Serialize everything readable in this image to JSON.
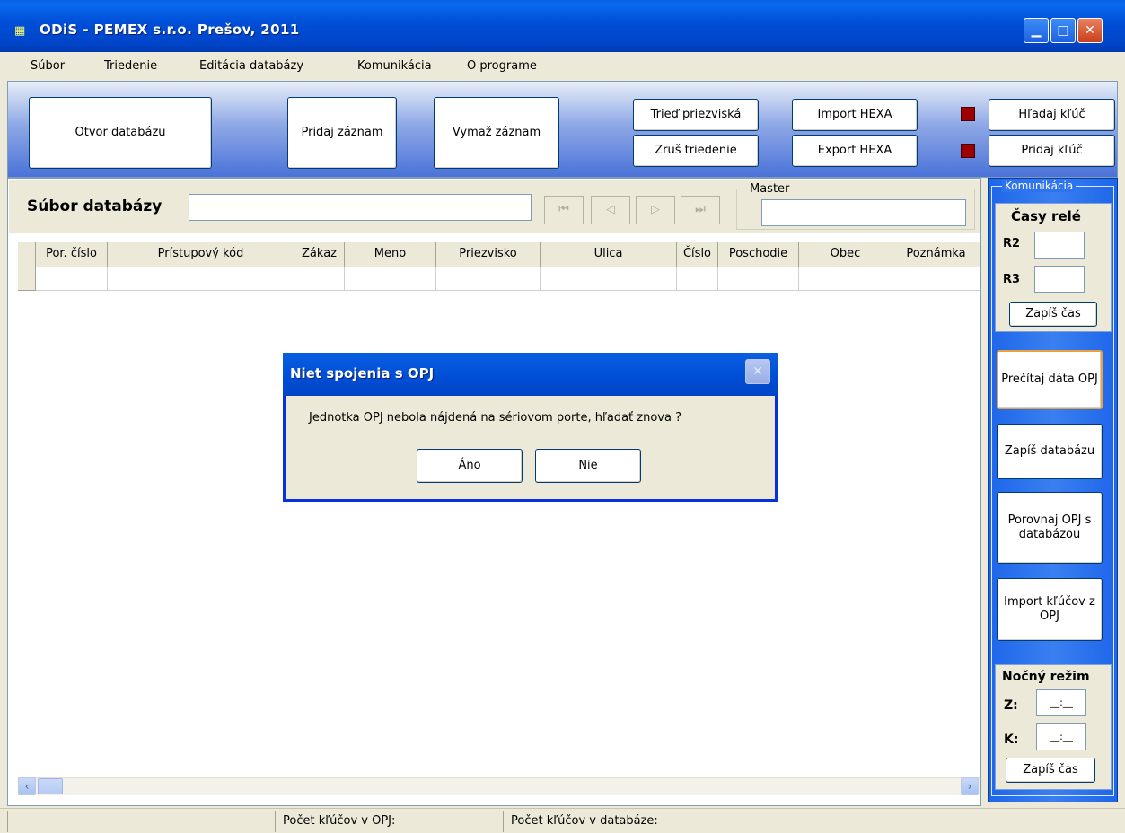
{
  "window": {
    "title": "ODiS  - PEMEX s.r.o. Prešov, 2011",
    "app_icon": "app-logo-icon",
    "controls": {
      "minimize": "▁",
      "maximize": "□",
      "close": "✕"
    }
  },
  "menu": [
    "Súbor",
    "Triedenie",
    "Editácia databázy",
    "Komunikácia",
    "O programe"
  ],
  "toolbar": {
    "open_db": "Otvor databázu",
    "add_record": "Pridaj záznam",
    "delete_record": "Vymaž záznam",
    "sort_surnames": "Trieď priezviská",
    "cancel_sort": "Zruš triedenie",
    "import_hexa": "Import HEXA",
    "export_hexa": "Export HEXA",
    "find_key": "Hľadaj kľúč",
    "add_key": "Pridaj kľúč"
  },
  "file_panel": {
    "label": "Súbor databázy",
    "value": "",
    "nav": {
      "first": "⏮",
      "prev": "◁",
      "next": "▷",
      "last": "⏭"
    },
    "master_label": "Master",
    "master_value": ""
  },
  "grid": {
    "columns": [
      "Por. číslo",
      "Prístupový kód",
      "Zákaz",
      "Meno",
      "Priezvisko",
      "Ulica",
      "Číslo",
      "Poschodie",
      "Obec",
      "Poznámka"
    ],
    "rows": [
      [
        "",
        "",
        "",
        "",
        "",
        "",
        "",
        "",
        "",
        ""
      ]
    ]
  },
  "side": {
    "group_label": "Komunikácia",
    "relay_title": "Časy relé",
    "r2_label": "R2",
    "r2_value": "",
    "r3_label": "R3",
    "r3_value": "",
    "write_time": "Zapíš čas",
    "read_opj": "Prečítaj dáta OPJ",
    "write_db": "Zapíš databázu",
    "compare": "Porovnaj OPJ s databázou",
    "import_keys": "Import kľúčov z OPJ",
    "night_title": "Nočný režim",
    "z_label": "Z:",
    "z_value": "__:__",
    "k_label": "K:",
    "k_value": "__:__",
    "write_time2": "Zapíš čas"
  },
  "status": {
    "keys_opj": "Počet kľúčov v OPJ:",
    "keys_db": "Počet kľúčov v databáze:"
  },
  "dialog": {
    "title": "Niet spojenia s OPJ",
    "message": "Jednotka OPJ nebola nájdená na sériovom porte, hľadať znova ?",
    "yes": "Áno",
    "no": "Nie",
    "close": "✕"
  },
  "scroll": {
    "left": "‹",
    "right": "›"
  },
  "colors": {
    "title_blue": "#0050D8",
    "led_red": "#9C0000",
    "panel_blue": "#2E74EE"
  }
}
